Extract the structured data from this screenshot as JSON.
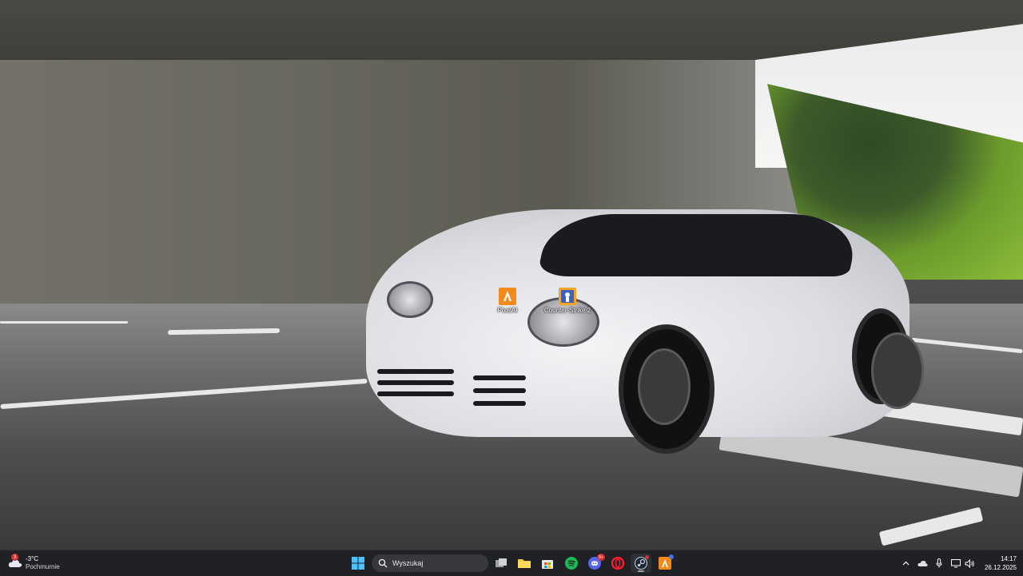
{
  "desktop": {
    "wallpaper": "white-sports-car-under-bridge",
    "icons": [
      {
        "label": "PixelAI",
        "icon": "orange-app-icon",
        "color": "#f28a1c"
      },
      {
        "label": "Counter-Strike 2",
        "icon": "counter-strike-icon",
        "color": "#3f5fb8"
      }
    ]
  },
  "taskbar": {
    "weather": {
      "temperature": "-3°C",
      "condition": "Pochmurnie",
      "badge": "3",
      "icon": "cloud-weather-icon"
    },
    "start_icon": "windows-start-icon",
    "search": {
      "placeholder": "Wyszukaj",
      "icon": "search-icon"
    },
    "apps": [
      {
        "name": "task-view",
        "icon": "task-view-icon"
      },
      {
        "name": "file-explorer",
        "icon": "folder-icon"
      },
      {
        "name": "microsoft-store",
        "icon": "store-icon"
      },
      {
        "name": "spotify",
        "icon": "spotify-icon"
      },
      {
        "name": "discord",
        "icon": "discord-icon",
        "badge": "9+"
      },
      {
        "name": "opera",
        "icon": "opera-icon"
      },
      {
        "name": "steam",
        "icon": "steam-icon"
      },
      {
        "name": "pixelai",
        "icon": "orange-app-icon"
      }
    ],
    "tray": [
      "chevron-up-icon",
      "onedrive-cloud-icon",
      "microphone-icon",
      "display-icon",
      "volume-icon"
    ],
    "clock": {
      "time": "14:17",
      "date": "26.12.2025"
    }
  },
  "colors": {
    "taskbar": "#202125",
    "accent": "#0078d4",
    "spotify": "#1db954",
    "discord": "#5865f2",
    "opera": "#ff1b2d"
  }
}
